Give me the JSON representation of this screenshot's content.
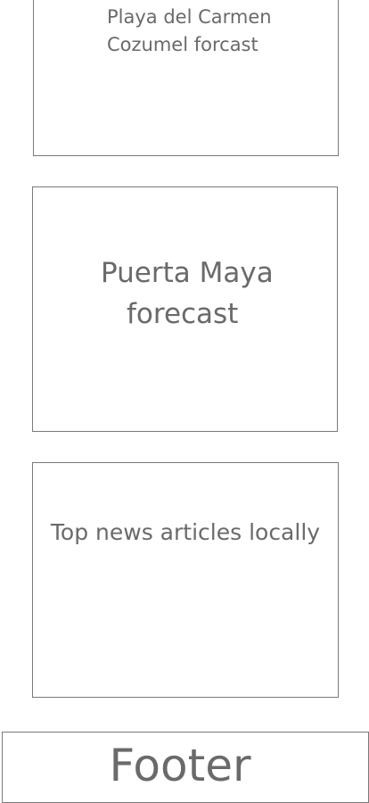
{
  "cards": {
    "playa": {
      "line1": "Playa del Carmen",
      "line2": "Cozumel forcast"
    },
    "puerta": {
      "line1": "Puerta Maya",
      "line2": "forecast"
    },
    "news": {
      "text": "Top news articles locally"
    }
  },
  "footer": {
    "label": "Footer"
  }
}
